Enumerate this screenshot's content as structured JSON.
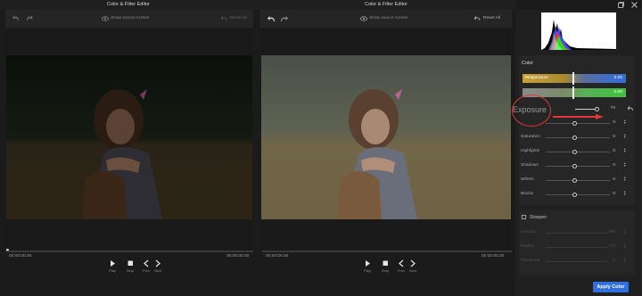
{
  "left_pane": {
    "title": "Color & Filter Editor",
    "show_source_label": "Show source screen",
    "reset_label": "Reset all",
    "time_start": "00:00:00.00",
    "time_end": "00:00:00.00",
    "controls": {
      "play": "Play",
      "stop": "Stop",
      "prev": "Prev",
      "next": "Next"
    }
  },
  "right_pane": {
    "title": "Color & Filter Editor",
    "show_source_label": "Show source screen",
    "reset_label": "Reset All",
    "time_start": "00:00:00.00",
    "time_end": "00:00:00.00",
    "controls": {
      "play": "Play",
      "stop": "Stop",
      "prev": "Prev",
      "next": "Next"
    }
  },
  "color_panel": {
    "title": "Color",
    "temperature": {
      "label": "Temperature",
      "value": "0.00"
    },
    "tint": {
      "value": "0.00"
    },
    "exposure": {
      "label": "Exposure",
      "value": "76"
    },
    "sliders": [
      {
        "label": "",
        "value": "0"
      },
      {
        "label": "Saturation",
        "value": "0"
      },
      {
        "label": "Highlights",
        "value": "0"
      },
      {
        "label": "Shadows",
        "value": "0"
      },
      {
        "label": "Whites",
        "value": "0"
      },
      {
        "label": "Blacks",
        "value": "0"
      }
    ]
  },
  "sharpen_panel": {
    "title": "Sharpen",
    "sliders": [
      {
        "label": "Amount",
        "value": "100"
      },
      {
        "label": "Radius",
        "value": "0.0"
      },
      {
        "label": "Threshold",
        "value": "0"
      }
    ]
  },
  "apply_button": "Apply Color",
  "colors": {
    "accent": "#2f6fe0",
    "annotation": "#e0383a",
    "temperature_start": "#c8a23a",
    "temperature_end": "#2f6fe0",
    "tint_start": "#8a8a8a",
    "tint_end": "#3cc43c"
  }
}
